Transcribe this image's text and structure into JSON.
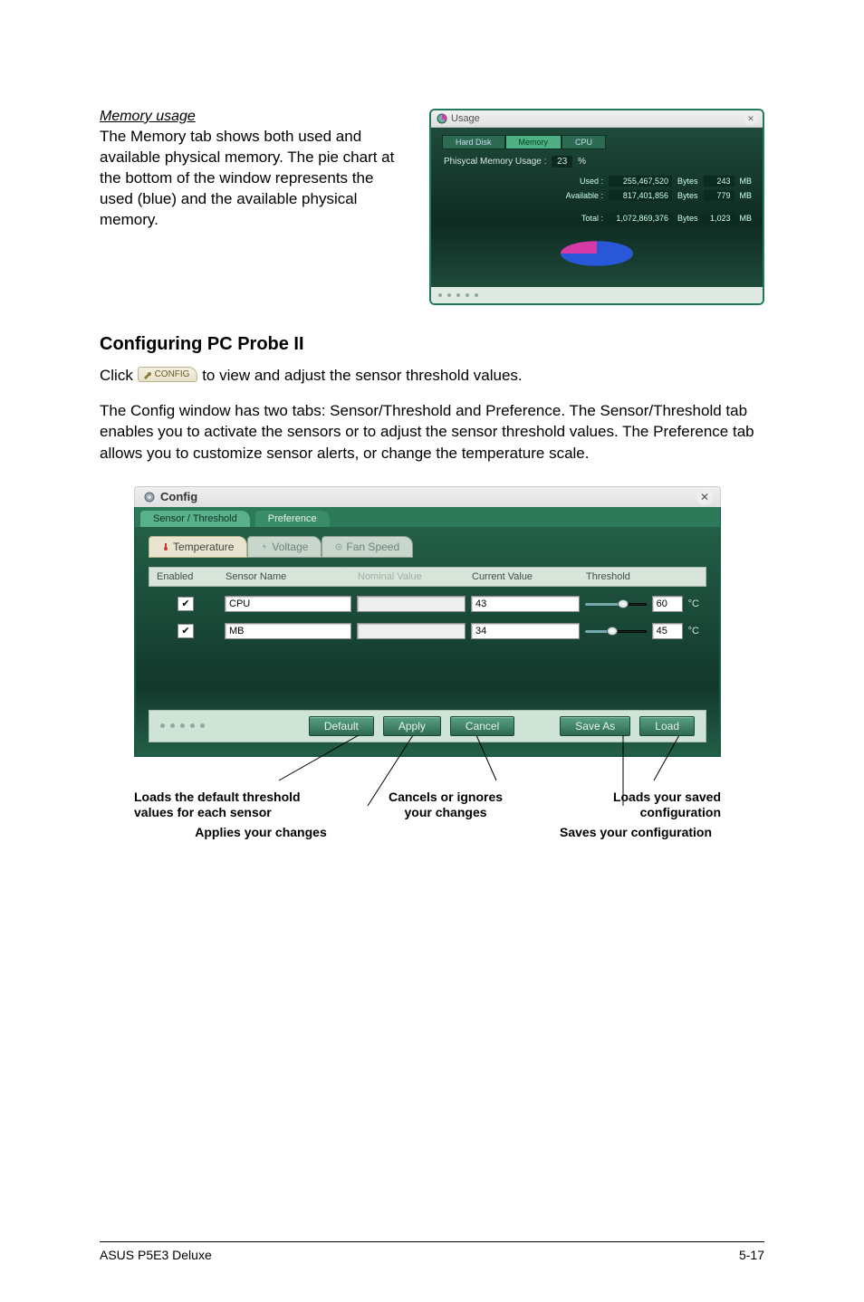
{
  "memory": {
    "heading": "Memory usage",
    "body": "The Memory tab shows both used and available physical memory. The pie chart at the bottom of the window represents the used (blue) and the available physical memory."
  },
  "usageWindow": {
    "title": "Usage",
    "tabs": {
      "hd": "Hard Disk",
      "mem": "Memory",
      "cpu": "CPU"
    },
    "labelPrefix": "Phisycal Memory Usage :",
    "pct": "23",
    "pctSuffix": "%",
    "rows": {
      "used": {
        "label": "Used :",
        "bytes": "255,467,520",
        "unit": "Bytes",
        "mb": "243",
        "munit": "MB"
      },
      "avail": {
        "label": "Available :",
        "bytes": "817,401,856",
        "unit": "Bytes",
        "mb": "779",
        "munit": "MB"
      },
      "total": {
        "label": "Total :",
        "bytes": "1,072,869,376",
        "unit": "Bytes",
        "mb": "1,023",
        "munit": "MB"
      }
    }
  },
  "section": {
    "title": "Configuring PC Probe II",
    "clickPrefix": "Click ",
    "chipLabel": "CONFIG",
    "clickSuffix": " to view and adjust the sensor threshold values.",
    "para": "The Config window has two tabs: Sensor/Threshold and Preference. The Sensor/Threshold tab enables you to activate the sensors or to adjust the sensor threshold values. The Preference tab allows you to customize sensor alerts, or change the temperature scale."
  },
  "configWindow": {
    "title": "Config",
    "outerTabs": {
      "sensor": "Sensor / Threshold",
      "pref": "Preference"
    },
    "innerTabs": {
      "temperature": "Temperature",
      "voltage": "Voltage",
      "fan": "Fan Speed"
    },
    "columns": {
      "enabled": "Enabled",
      "sensorName": "Sensor Name",
      "nominal": "Nominal Value",
      "current": "Current Value",
      "threshold": "Threshold"
    },
    "rows": [
      {
        "enabled": true,
        "name": "CPU",
        "nominal": "",
        "current": "43",
        "threshold": "60",
        "unit": "°C",
        "sliderPct": 62
      },
      {
        "enabled": true,
        "name": "MB",
        "nominal": "",
        "current": "34",
        "threshold": "45",
        "unit": "°C",
        "sliderPct": 45
      }
    ],
    "buttons": {
      "default": "Default",
      "apply": "Apply",
      "cancel": "Cancel",
      "saveAs": "Save As",
      "load": "Load"
    }
  },
  "callouts": {
    "default": "Loads the default threshold values for each sensor",
    "apply": "Applies your changes",
    "cancel": "Cancels or ignores your changes",
    "load": "Loads your saved configuration",
    "save": "Saves your configuration"
  },
  "chart_data": {
    "type": "pie",
    "title": "Physical Memory Usage",
    "series": [
      {
        "name": "Used",
        "value_bytes": 255467520,
        "value_mb": 243,
        "color": "#2858d8"
      },
      {
        "name": "Available",
        "value_bytes": 817401856,
        "value_mb": 779,
        "color": "#d63aa7"
      }
    ],
    "total_bytes": 1072869376,
    "total_mb": 1023,
    "used_pct": 23
  },
  "footer": {
    "left": "ASUS P5E3 Deluxe",
    "right": "5-17"
  }
}
